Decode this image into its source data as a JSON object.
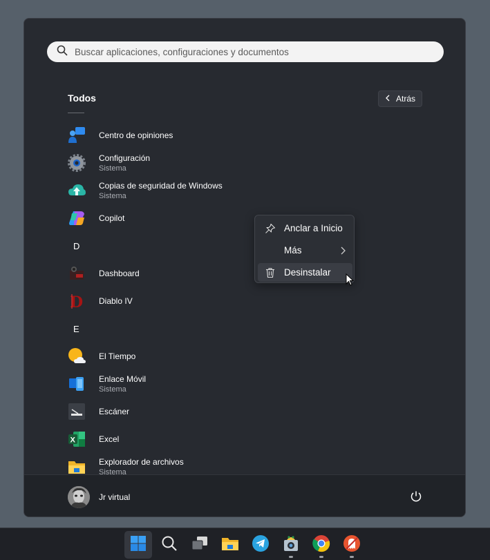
{
  "search": {
    "placeholder": "Buscar aplicaciones, configuraciones y documentos"
  },
  "header": {
    "section_title": "Todos",
    "back_label": "Atrás"
  },
  "apps": [
    {
      "name": "Centro de opiniones",
      "subtitle": "",
      "icon": "feedback-hub-icon"
    },
    {
      "name": "Configuración",
      "subtitle": "Sistema",
      "icon": "settings-gear-icon"
    },
    {
      "name": "Copias de seguridad de Windows",
      "subtitle": "Sistema",
      "icon": "cloud-backup-icon"
    },
    {
      "name": "Copilot",
      "subtitle": "",
      "icon": "copilot-icon"
    },
    {
      "letter": "D"
    },
    {
      "name": "Dashboard",
      "subtitle": "",
      "icon": "dashboard-icon"
    },
    {
      "name": "Diablo IV",
      "subtitle": "",
      "icon": "diablo-icon"
    },
    {
      "letter": "E"
    },
    {
      "name": "El Tiempo",
      "subtitle": "",
      "icon": "weather-icon"
    },
    {
      "name": "Enlace Móvil",
      "subtitle": "Sistema",
      "icon": "phone-link-icon"
    },
    {
      "name": "Escáner",
      "subtitle": "",
      "icon": "scanner-icon"
    },
    {
      "name": "Excel",
      "subtitle": "",
      "icon": "excel-icon"
    },
    {
      "name": "Explorador de archivos",
      "subtitle": "Sistema",
      "icon": "file-explorer-icon"
    }
  ],
  "context_menu": {
    "items": [
      {
        "label": "Anclar a Inicio",
        "icon": "pin-icon"
      },
      {
        "label": "Más",
        "icon": "chevron-right-icon"
      },
      {
        "label": "Desinstalar",
        "icon": "trash-icon"
      }
    ]
  },
  "footer": {
    "user_name": "Jr virtual"
  },
  "taskbar": {
    "items": [
      "start-icon",
      "search-icon",
      "task-view-icon",
      "file-explorer-icon",
      "telegram-icon",
      "camera-app-icon",
      "chrome-icon",
      "ghost-app-icon"
    ]
  },
  "colors": {
    "menu_bg": "#272a30",
    "desktop": "#56606a",
    "taskbar": "#1f2126",
    "accent": "#0f78d4"
  }
}
